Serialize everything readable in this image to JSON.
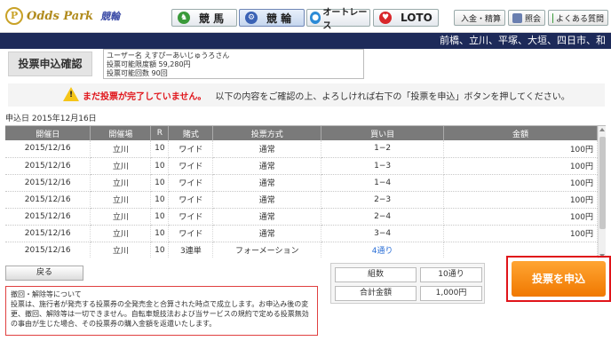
{
  "header": {
    "logo_text": "Odds Park",
    "logo_keirin": "競輪",
    "nav_tabs": [
      {
        "label": "競 馬",
        "icon": "horse-icon"
      },
      {
        "label": "競 輪",
        "icon": "bicycle-icon"
      },
      {
        "label": "オートレース",
        "icon": "motorcycle-icon"
      },
      {
        "label": "LOTO",
        "icon": "loto-icon"
      }
    ],
    "utility_buttons": [
      {
        "label": "入金・精算",
        "icon": "deposit-icon"
      },
      {
        "label": "照会",
        "icon": "book-icon"
      },
      {
        "label": "よくある質問",
        "icon": "help-icon"
      }
    ]
  },
  "venues_bar": "前橋、立川、平塚、大垣、四日市、和",
  "confirm_label": "投票申込確認",
  "user_info": {
    "line1": "ユーザー名 えすぴーあいじゅうろさん",
    "line2": "投票可能限度額 59,280円",
    "line3": "投票可能回数 90回"
  },
  "warning": {
    "strong": "まだ投票が完了していません。",
    "text": "以下の内容をご確認の上、よろしければ右下の「投票を申込」ボタンを押してください。"
  },
  "application_date": "申込日 2015年12月16日",
  "table": {
    "headers": [
      "開催日",
      "開催場",
      "R",
      "賭式",
      "投票方式",
      "買い目",
      "金額"
    ],
    "rows": [
      [
        "2015/12/16",
        "立川",
        "10",
        "ワイド",
        "通常",
        "1−2",
        "100円"
      ],
      [
        "2015/12/16",
        "立川",
        "10",
        "ワイド",
        "通常",
        "1−3",
        "100円"
      ],
      [
        "2015/12/16",
        "立川",
        "10",
        "ワイド",
        "通常",
        "1−4",
        "100円"
      ],
      [
        "2015/12/16",
        "立川",
        "10",
        "ワイド",
        "通常",
        "2−3",
        "100円"
      ],
      [
        "2015/12/16",
        "立川",
        "10",
        "ワイド",
        "通常",
        "2−4",
        "100円"
      ],
      [
        "2015/12/16",
        "立川",
        "10",
        "ワイド",
        "通常",
        "3−4",
        "100円"
      ],
      [
        "2015/12/16",
        "立川",
        "10",
        "3連単",
        "フォーメーション",
        "4通り",
        ""
      ]
    ]
  },
  "back_button": "戻る",
  "notice": {
    "title": "撤回・解除等について",
    "body": "投票は、施行者が発売する投票券の全発売金と合算された時点で成立します。お申込み後の変更、撤回、解除等は一切できません。自転車競技法および当サービスの規約で定める投票無効の事由が生じた場合、その投票券の購入金額を返還いたします。"
  },
  "summary": {
    "count_label": "組数",
    "count_value": "10通り",
    "total_label": "合計金額",
    "total_value": "1,000円"
  },
  "submit_button": "投票を申込",
  "colors": {
    "venue_bar": "#1d2a59",
    "warning_red": "#e0141a",
    "submit_orange": "#f07800",
    "table_header": "#7a7a7a"
  }
}
